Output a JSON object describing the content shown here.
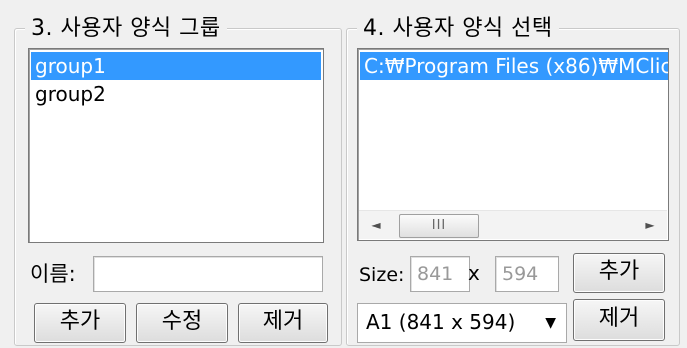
{
  "group_list": {
    "title": "3. 사용자 양식 그룹",
    "items": [
      {
        "label": "group1",
        "selected": true
      },
      {
        "label": "group2",
        "selected": false
      }
    ],
    "name_label": "이름:",
    "name_value": "",
    "buttons": {
      "add": "추가",
      "edit": "수정",
      "remove": "제거"
    }
  },
  "template_select": {
    "title": "4. 사용자 양식 선택",
    "items": [
      {
        "label": "C:₩Program Files (x86)₩MClick",
        "selected": true
      }
    ],
    "scrollbar": {
      "left_icon": "◄",
      "right_icon": "►",
      "thumb_grip": "III"
    },
    "size_label": "Size:",
    "width_value": "841",
    "times_symbol": "x",
    "height_value": "594",
    "add_button": "추가",
    "paper_select": "A1 (841 x 594)",
    "select_arrow": "▼",
    "remove_button": "제거"
  },
  "colors": {
    "selection": "#3399ff",
    "background": "#f0f0f0"
  }
}
